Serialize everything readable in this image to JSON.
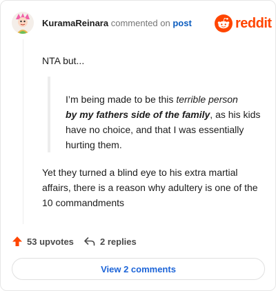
{
  "header": {
    "username": "KuramaReinara",
    "commented_on": "commented on",
    "post_link": "post",
    "brand": "reddit"
  },
  "comment": {
    "intro": "NTA but...",
    "quote": {
      "part1": "I’m being made to be this ",
      "italic": "terrible person",
      "bold_italic": "by my fathers side of the family",
      "part2": ", as his kids have no choice, and that I was essentially hurting them."
    },
    "paragraph": "Yet they turned a blind eye to his extra martial affairs, there is a reason why adultery is one of the 10 commandments"
  },
  "actions": {
    "upvotes": "53 upvotes",
    "replies": "2 replies"
  },
  "footer": {
    "view_comments": "View 2 comments"
  },
  "colors": {
    "brand": "#ff4500",
    "link": "#0b5cbf",
    "button_text": "#1c64d8"
  },
  "icons": {
    "avatar": "avatar",
    "brand_logo": "reddit-snoo-icon",
    "upvote": "upvote-arrow-icon",
    "reply": "reply-arrow-icon"
  }
}
